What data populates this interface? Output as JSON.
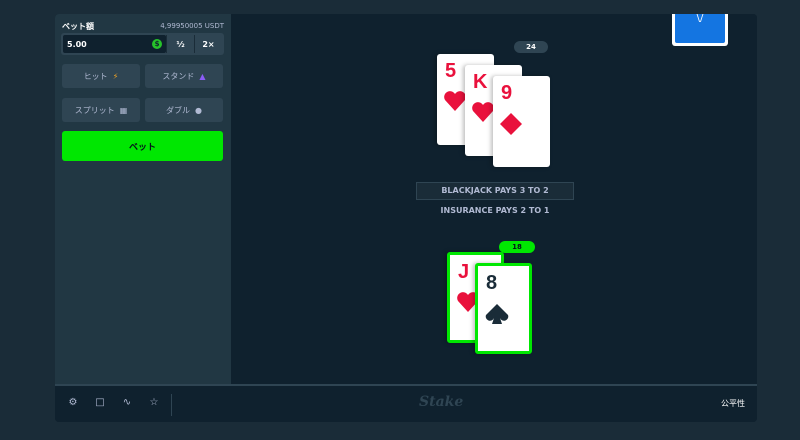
{
  "sidebar": {
    "bet_amount_label": "ベット額",
    "balance": "4,99950005 USDT",
    "bet_value": "5.00",
    "coin_symbol": "$",
    "half_label": "½",
    "double_label": "2×",
    "hit_label": "ヒット",
    "stand_label": "スタンド",
    "split_label": "スプリット",
    "doubledown_label": "ダブル",
    "bet_button": "ベット"
  },
  "dealer": {
    "total": "24",
    "cards": [
      {
        "rank": "5",
        "suit": "hearts"
      },
      {
        "rank": "K",
        "suit": "hearts"
      },
      {
        "rank": "9",
        "suit": "diamonds"
      }
    ]
  },
  "table_text": {
    "banner": "BLACKJACK PAYS 3 TO 2",
    "insurance": "INSURANCE PAYS 2 TO 1"
  },
  "player": {
    "total": "18",
    "cards": [
      {
        "rank": "J",
        "suit": "hearts"
      },
      {
        "rank": "8",
        "suit": "spades"
      }
    ]
  },
  "deck": {
    "mark": "\\/"
  },
  "footer": {
    "logo": "Stake",
    "fairness": "公平性",
    "icons": [
      "gear-icon",
      "theatre-icon",
      "stats-icon",
      "star-icon"
    ]
  },
  "colors": {
    "accent_green": "#00e701",
    "card_red": "#e9113c",
    "panel": "#213743",
    "background": "#0f212e"
  }
}
